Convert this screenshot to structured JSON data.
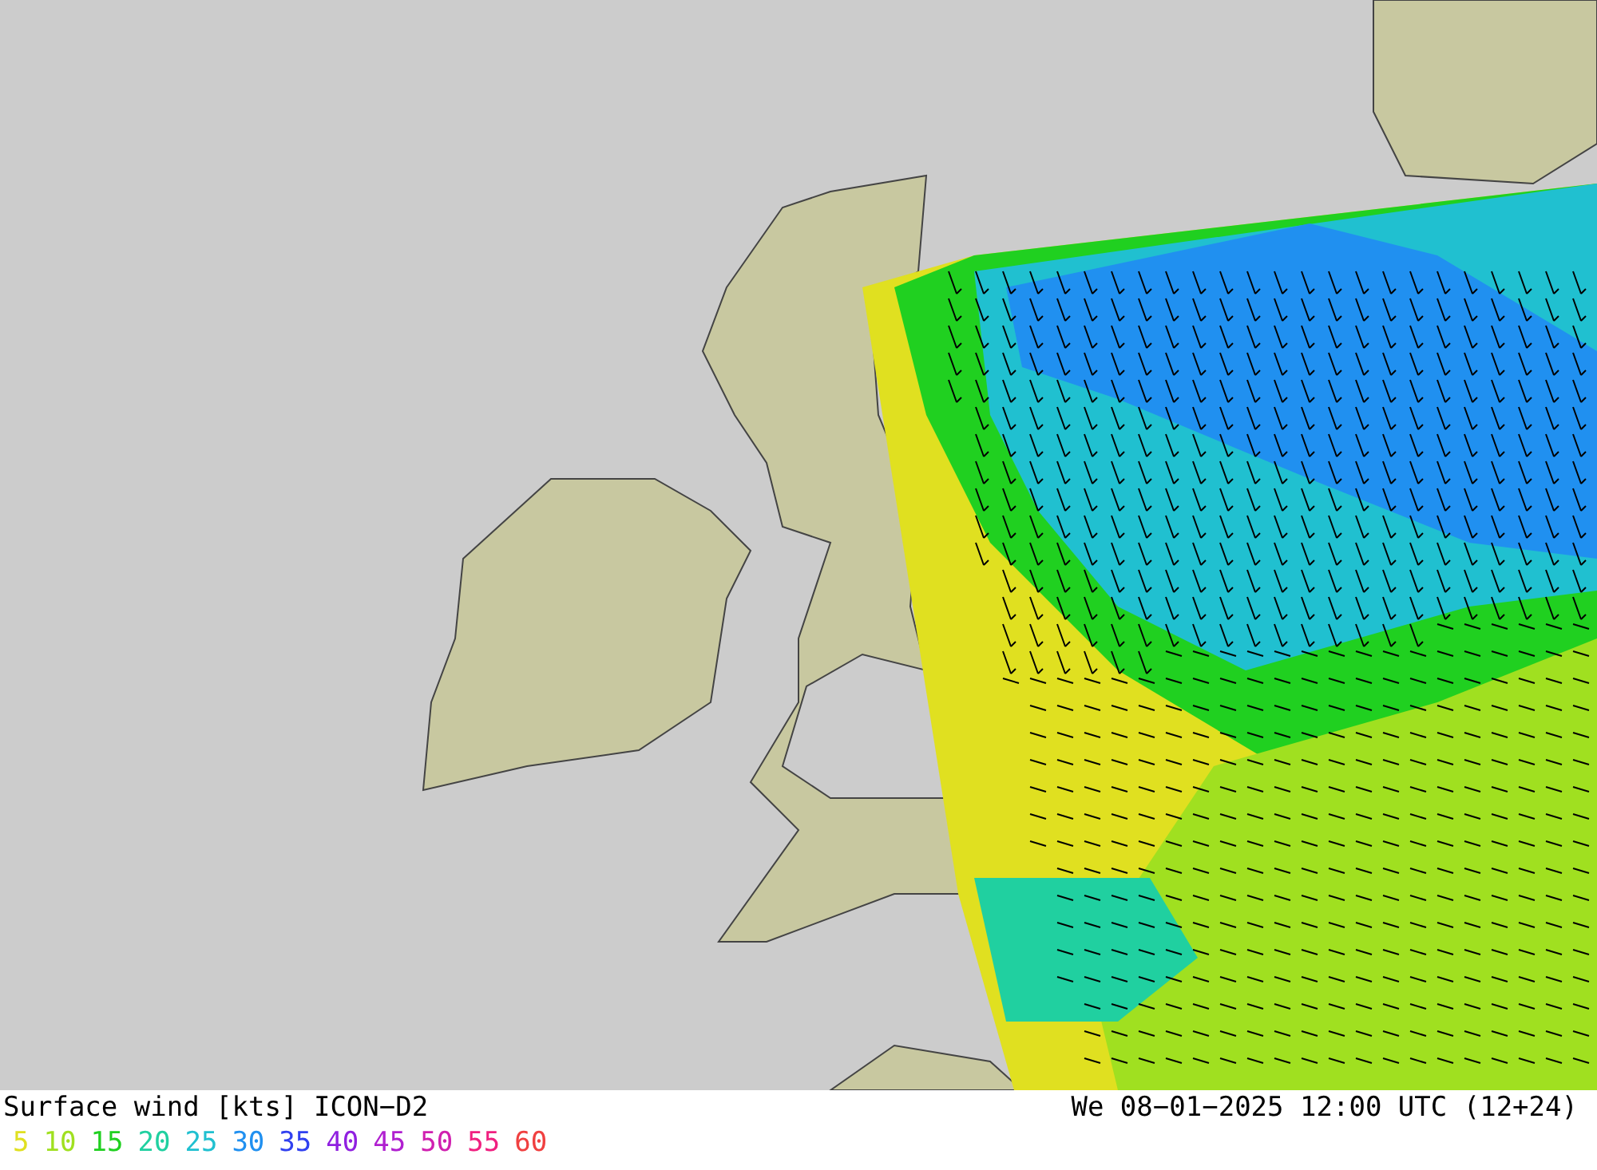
{
  "map": {
    "title": "Surface wind [kts] ICON−D2",
    "valid_time": "We 08−01−2025 12:00 UTC (12+24)"
  },
  "legend": [
    {
      "label": "5",
      "color": "#e0e020"
    },
    {
      "label": "10",
      "color": "#a0e020"
    },
    {
      "label": "15",
      "color": "#20d020"
    },
    {
      "label": "20",
      "color": "#20d0a0"
    },
    {
      "label": "25",
      "color": "#20c0d0"
    },
    {
      "label": "30",
      "color": "#2090f0"
    },
    {
      "label": "35",
      "color": "#3040f0"
    },
    {
      "label": "40",
      "color": "#9020e0"
    },
    {
      "label": "45",
      "color": "#b020d0"
    },
    {
      "label": "50",
      "color": "#d020b0"
    },
    {
      "label": "55",
      "color": "#f02080"
    },
    {
      "label": "60",
      "color": "#f04040"
    }
  ]
}
